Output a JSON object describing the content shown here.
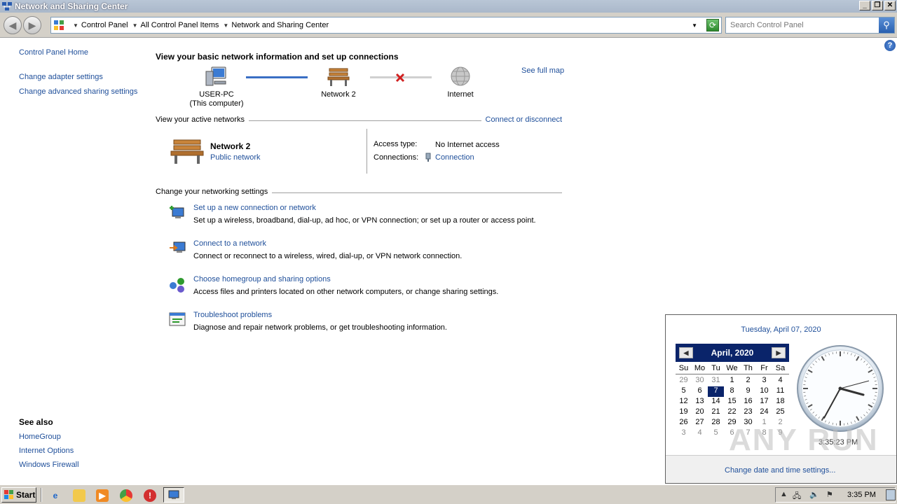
{
  "window": {
    "title": "Network and Sharing Center",
    "minimize": "_",
    "maximize": "❐",
    "close": "✕"
  },
  "address": {
    "breadcrumbs": [
      "Control Panel",
      "All Control Panel Items",
      "Network and Sharing Center"
    ],
    "search_placeholder": "Search Control Panel"
  },
  "left_pane": {
    "home": "Control Panel Home",
    "links": [
      "Change adapter settings",
      "Change advanced sharing settings"
    ],
    "see_also_heading": "See also",
    "see_also": [
      "HomeGroup",
      "Internet Options",
      "Windows Firewall"
    ]
  },
  "main": {
    "title": "View your basic network information and set up connections",
    "map": {
      "computer_name": "USER-PC",
      "computer_sub": "(This computer)",
      "network_name": "Network  2",
      "internet_label": "Internet",
      "see_full_map": "See full map"
    },
    "active_section": {
      "label": "View your active networks",
      "action": "Connect or disconnect"
    },
    "active_network": {
      "name": "Network  2",
      "type": "Public network",
      "access_type_label": "Access type:",
      "access_type_value": "No Internet access",
      "connections_label": "Connections:",
      "connections_value": "Connection"
    },
    "settings_section": {
      "label": "Change your networking settings"
    },
    "tasks": [
      {
        "title": "Set up a new connection or network",
        "desc": "Set up a wireless, broadband, dial-up, ad hoc, or VPN connection; or set up a router or access point."
      },
      {
        "title": "Connect to a network",
        "desc": "Connect or reconnect to a wireless, wired, dial-up, or VPN network connection."
      },
      {
        "title": "Choose homegroup and sharing options",
        "desc": "Access files and printers located on other network computers, or change sharing settings."
      },
      {
        "title": "Troubleshoot problems",
        "desc": "Diagnose and repair network problems, or get troubleshooting information."
      }
    ]
  },
  "calendar": {
    "full_date": "Tuesday, April 07, 2020",
    "month_label": "April, 2020",
    "weekdays": [
      "Su",
      "Mo",
      "Tu",
      "We",
      "Th",
      "Fr",
      "Sa"
    ],
    "rows": [
      [
        "29",
        "30",
        "31",
        "1",
        "2",
        "3",
        "4"
      ],
      [
        "5",
        "6",
        "7",
        "8",
        "9",
        "10",
        "11"
      ],
      [
        "12",
        "13",
        "14",
        "15",
        "16",
        "17",
        "18"
      ],
      [
        "19",
        "20",
        "21",
        "22",
        "23",
        "24",
        "25"
      ],
      [
        "26",
        "27",
        "28",
        "29",
        "30",
        "1",
        "2"
      ],
      [
        "3",
        "4",
        "5",
        "6",
        "7",
        "8",
        "9"
      ]
    ],
    "time": "3:35:23 PM",
    "footer_link": "Change date and time settings..."
  },
  "watermark": "ANY RUN",
  "taskbar": {
    "start_label": "Start",
    "clock": "3:35 PM"
  },
  "colors": {
    "link": "#1f4f9a",
    "calendar_header": "#0a246a",
    "taskbar": "#d4d0c8"
  }
}
